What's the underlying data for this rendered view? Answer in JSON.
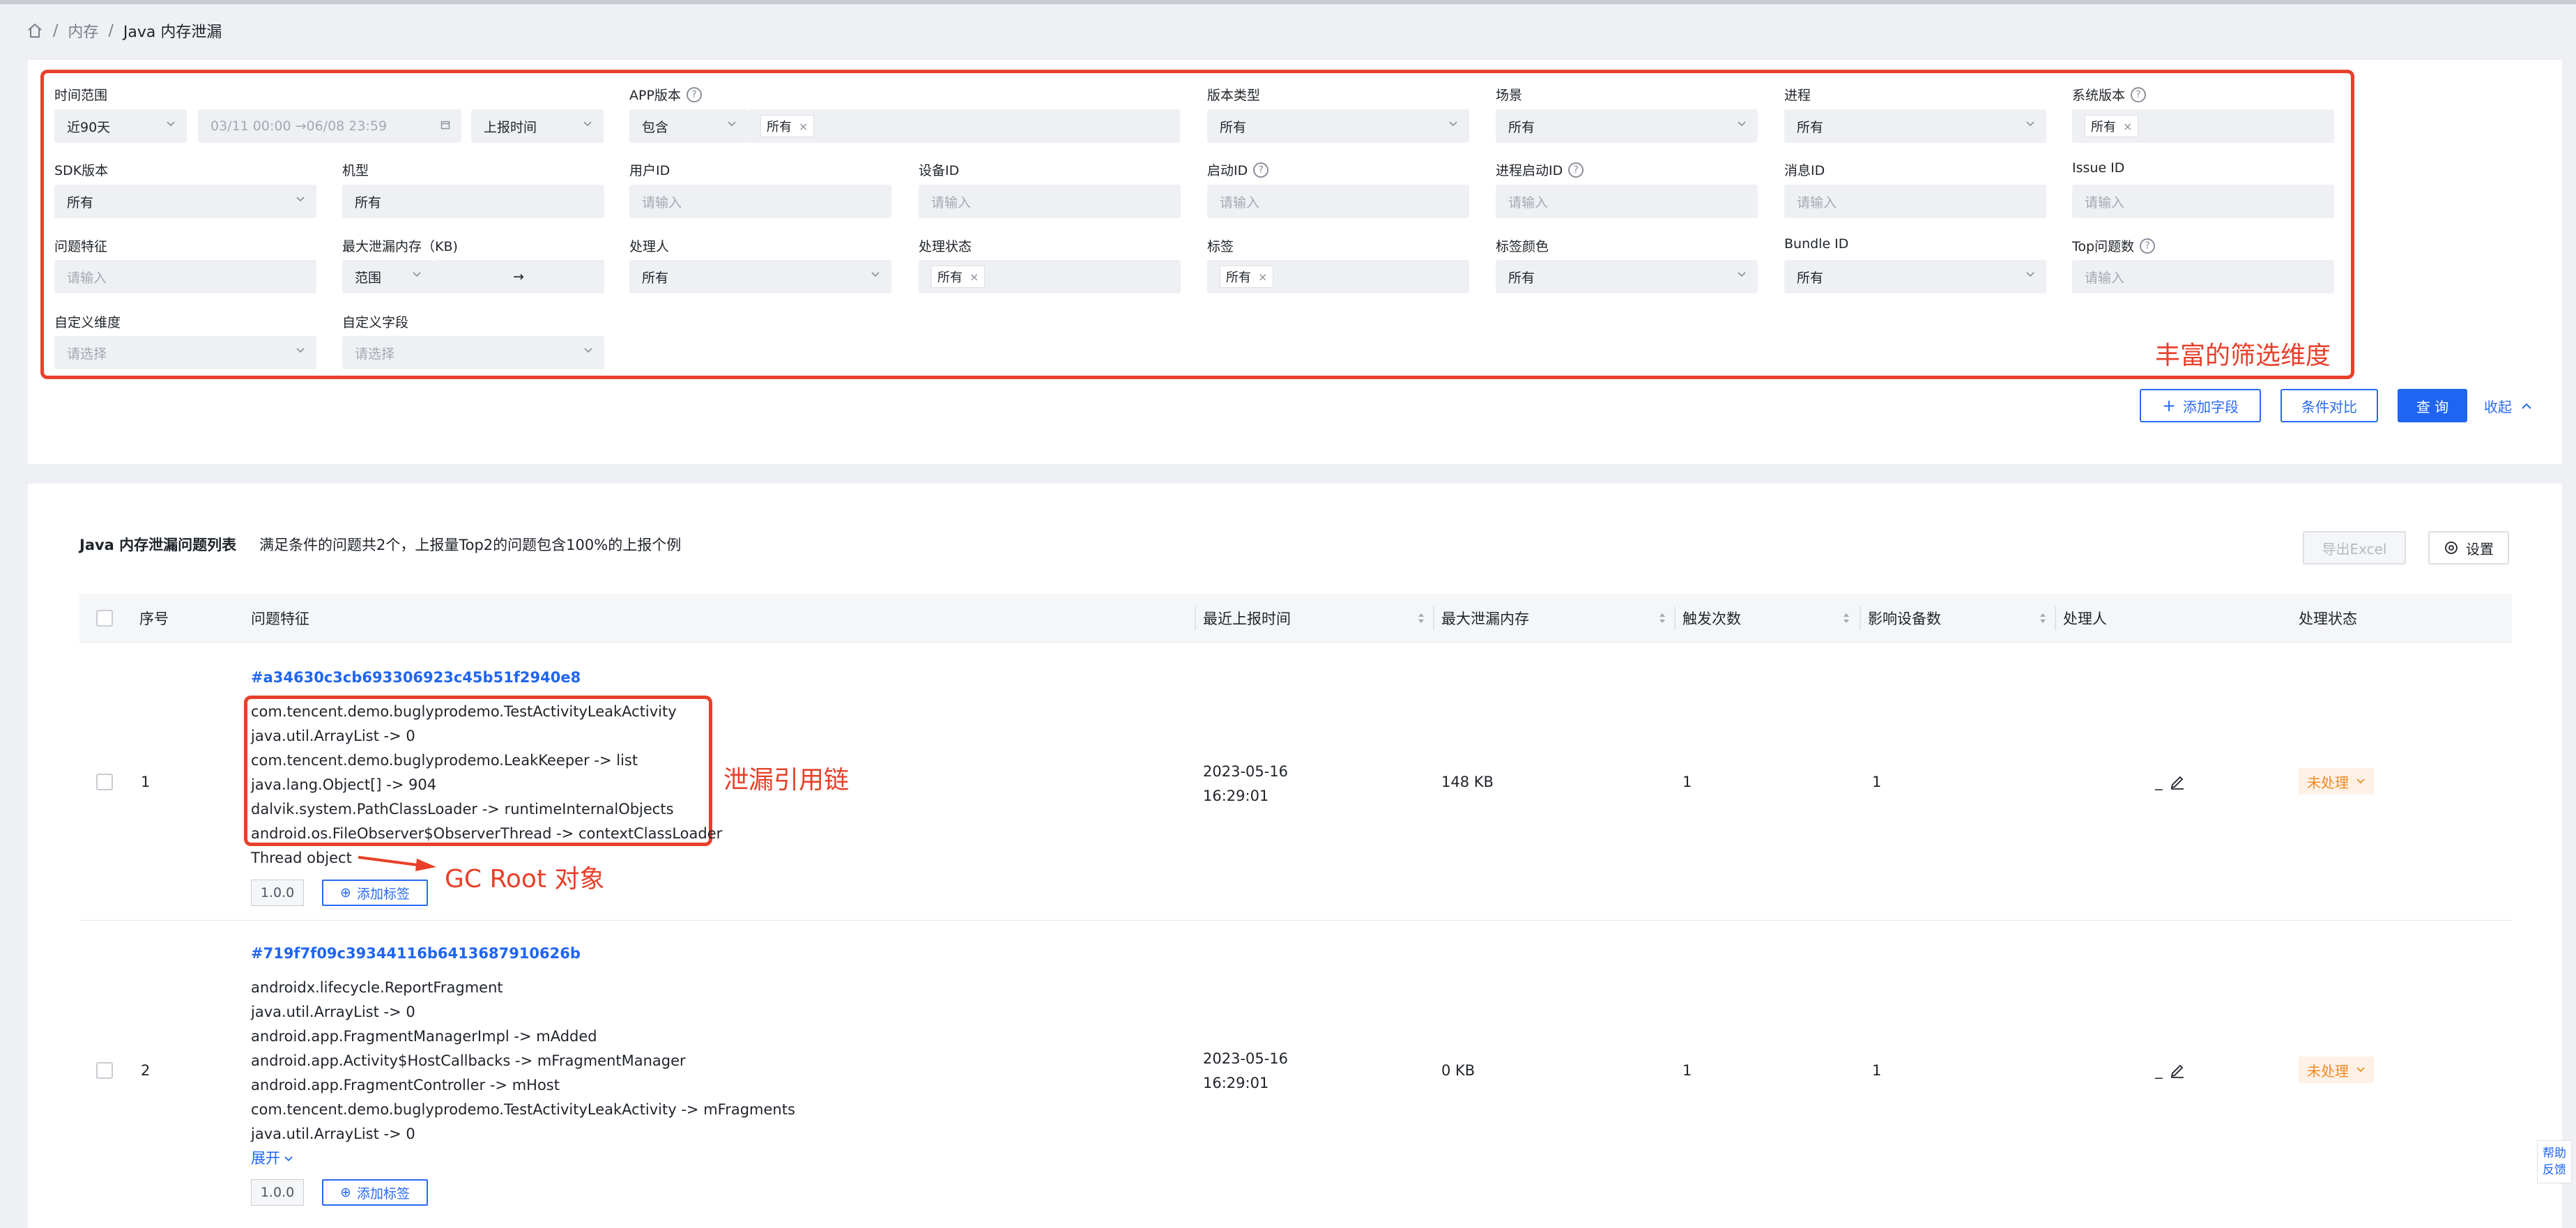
{
  "breadcrumb": {
    "home": "home",
    "items": [
      "内存",
      "Java 内存泄漏"
    ]
  },
  "filters": {
    "time_range": {
      "label": "时间范围",
      "value": "近90天",
      "date_range": "03/11 00:00  →06/08 23:59",
      "time_type": "上报时间"
    },
    "app_version": {
      "label": "APP版本",
      "mode": "包含",
      "chip": "所有"
    },
    "version_type": {
      "label": "版本类型",
      "value": "所有"
    },
    "scene": {
      "label": "场景",
      "value": "所有"
    },
    "process": {
      "label": "进程",
      "value": "所有"
    },
    "system_version": {
      "label": "系统版本",
      "chip": "所有"
    },
    "sdk_version": {
      "label": "SDK版本",
      "value": "所有"
    },
    "model": {
      "label": "机型",
      "value": "所有"
    },
    "user_id": {
      "label": "用户ID",
      "placeholder": "请输入"
    },
    "device_id": {
      "label": "设备ID",
      "placeholder": "请输入"
    },
    "launch_id": {
      "label": "启动ID",
      "placeholder": "请输入"
    },
    "process_launch_id": {
      "label": "进程启动ID",
      "placeholder": "请输入"
    },
    "message_id": {
      "label": "消息ID",
      "placeholder": "请输入"
    },
    "issue_id": {
      "label": "Issue ID",
      "placeholder": "请输入"
    },
    "issue_feature": {
      "label": "问题特征",
      "placeholder": "请输入"
    },
    "max_leak": {
      "label": "最大泄漏内存（KB)",
      "mode": "范围",
      "arrow": "→"
    },
    "handler": {
      "label": "处理人",
      "value": "所有"
    },
    "handle_status": {
      "label": "处理状态",
      "chip": "所有"
    },
    "tags": {
      "label": "标签",
      "chip": "所有"
    },
    "tag_color": {
      "label": "标签颜色",
      "value": "所有"
    },
    "bundle_id": {
      "label": "Bundle ID",
      "value": "所有"
    },
    "top_issues": {
      "label": "Top问题数",
      "placeholder": "请输入"
    },
    "custom_dimension": {
      "label": "自定义维度",
      "placeholder": "请选择"
    },
    "custom_field": {
      "label": "自定义字段",
      "placeholder": "请选择"
    }
  },
  "annotations": {
    "filters": "丰富的筛选维度",
    "chain": "泄漏引用链",
    "gc_root": "GC Root 对象"
  },
  "actions": {
    "add_field": "添加字段",
    "compare": "条件对比",
    "query": "查 询",
    "collapse": "收起"
  },
  "list": {
    "title": "Java 内存泄漏问题列表",
    "summary": "满足条件的问题共2个，上报量Top2的问题包含100%的上报个例",
    "export": "导出Excel",
    "settings": "设置",
    "columns": [
      "序号",
      "问题特征",
      "最近上报时间",
      "最大泄漏内存",
      "触发次数",
      "影响设备数",
      "处理人",
      "处理状态"
    ],
    "rows": [
      {
        "index": "1",
        "id": "#a34630c3cb693306923c45b51f2940e8",
        "stack": [
          "com.tencent.demo.buglyprodemo.TestActivityLeakActivity",
          "java.util.ArrayList -> 0",
          "com.tencent.demo.buglyprodemo.LeakKeeper -> list",
          "java.lang.Object[] -> 904",
          "dalvik.system.PathClassLoader -> runtimeInternalObjects",
          "android.os.FileObserver$ObserverThread -> contextClassLoader",
          "Thread object"
        ],
        "version": "1.0.0",
        "add_tag": "添加标签",
        "date": "2023-05-16",
        "time": "16:29:01",
        "max_leak": "148 KB",
        "triggers": "1",
        "devices": "1",
        "handler": "_",
        "status": "未处理"
      },
      {
        "index": "2",
        "id": "#719f7f09c39344116b6413687910626b",
        "stack": [
          "androidx.lifecycle.ReportFragment",
          "java.util.ArrayList -> 0",
          "android.app.FragmentManagerImpl -> mAdded",
          "android.app.Activity$HostCallbacks -> mFragmentManager",
          "android.app.FragmentController -> mHost",
          "com.tencent.demo.buglyprodemo.TestActivityLeakActivity -> mFragments",
          "java.util.ArrayList -> 0"
        ],
        "expand": "展开",
        "version": "1.0.0",
        "add_tag": "添加标签",
        "date": "2023-05-16",
        "time": "16:29:01",
        "max_leak": "0 KB",
        "triggers": "1",
        "devices": "1",
        "handler": "_",
        "status": "未处理"
      }
    ]
  },
  "help": {
    "line1": "帮助",
    "line2": "反馈"
  },
  "colors": {
    "accent": "#1f65f2",
    "annotation": "#e8402a",
    "status": "#f08a24"
  }
}
